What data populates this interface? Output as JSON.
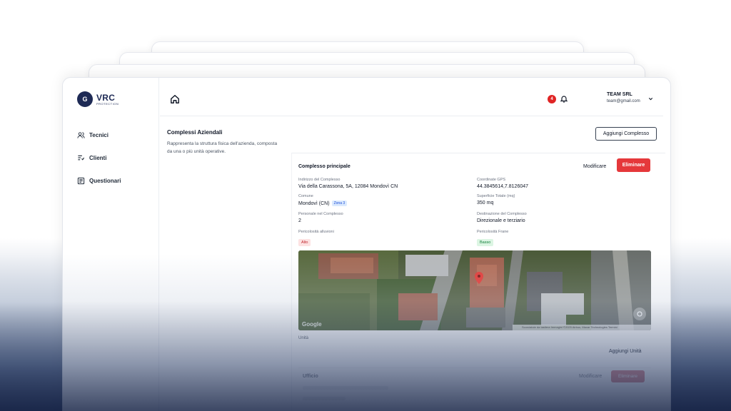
{
  "brand": {
    "logo_main": "VRC",
    "logo_sub": "PROTECTION",
    "logo_badge": "G"
  },
  "sidebar": {
    "items": [
      {
        "label": "Tecnici",
        "icon": "users-icon"
      },
      {
        "label": "Clienti",
        "icon": "list-filter-icon"
      },
      {
        "label": "Questionari",
        "icon": "clipboard-icon"
      }
    ]
  },
  "topbar": {
    "home_icon": "home-icon",
    "notification_count": "4",
    "bell_icon": "bell-icon",
    "user_name": "TEAM SRL",
    "user_email": "team@gmail.com"
  },
  "section": {
    "title": "Complessi Aziendali",
    "description": "Rappresenta la struttura fisica dell'azienda, composta da una o più unità operative.",
    "add_button": "Aggiungi Complesso"
  },
  "complex": {
    "title": "Complesso principale",
    "edit_label": "Modificare",
    "delete_label": "Eliminare",
    "fields": {
      "address_label": "Indirizzo del Complesso",
      "address_value": "Via della Carassona, 5A, 12084 Mondovì CN",
      "gps_label": "Coordinate GPS",
      "gps_value": "44.3845614,7.8126047",
      "comune_label": "Comune",
      "comune_value": "Mondovì (CN)",
      "zona_tag": "Zona 3",
      "superficie_label": "Superficie Totale (mq)",
      "superficie_value": "350 mq",
      "personale_label": "Personale nel Complesso",
      "personale_value": "2",
      "destinazione_label": "Destinazione del Complesso",
      "destinazione_value": "Direzionale e terziario",
      "alluvioni_label": "Pericolosità alluvioni",
      "alluvioni_value": "Alto",
      "frane_label": "Pericolosità Frane",
      "frane_value": "Basso"
    },
    "map": {
      "google_label": "Google",
      "attribution": "Scorciatoie da tastiera   Immagini ©2025 Airbus, Maxar Technologies   Termini"
    }
  },
  "units": {
    "label": "Unità",
    "add_button": "Aggiungi Unità",
    "rows": [
      {
        "name": "Ufficio",
        "edit_label": "Modificare",
        "delete_label": "Eliminare"
      }
    ]
  },
  "colors": {
    "brand_navy": "#1e2a55",
    "danger": "#e5383b",
    "risk_high_bg": "#fde2e2",
    "risk_low_bg": "#dcf5e3"
  }
}
